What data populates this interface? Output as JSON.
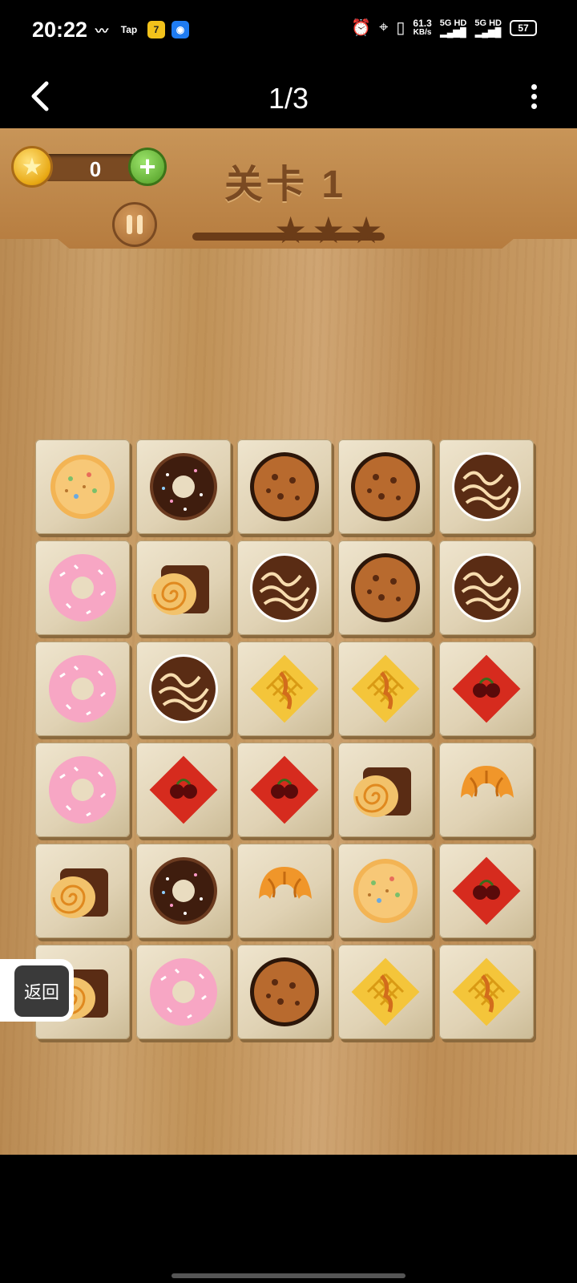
{
  "status_bar": {
    "time": "20:22",
    "left_icons": [
      "voice-wave-icon",
      "tap-icon",
      "seven-icon",
      "app-icon"
    ],
    "tap_text": "Tap",
    "seven_text": "7",
    "network_speed": "61.3",
    "network_unit": "KB/s",
    "signal1": "5G HD",
    "signal2": "5G HD",
    "battery": "57"
  },
  "nav": {
    "page_indicator": "1/3"
  },
  "game": {
    "coins": "0",
    "level_title": "关卡 1",
    "stars_earned": 0,
    "stars_total": 3,
    "return_label": "返回",
    "grid": [
      [
        "cookie",
        "choco-donut",
        "choc-chip",
        "choc-chip",
        "swirl-cookie"
      ],
      [
        "pink-donut",
        "swiss-roll",
        "swirl-cookie",
        "choc-chip",
        "swirl-cookie"
      ],
      [
        "pink-donut",
        "swirl-cookie",
        "waffle",
        "waffle",
        "cherry-diamond"
      ],
      [
        "pink-donut",
        "cherry-diamond",
        "cherry-diamond",
        "swiss-roll",
        "croissant"
      ],
      [
        "swiss-roll",
        "choco-donut",
        "croissant",
        "cookie",
        "cherry-diamond"
      ],
      [
        "swiss-roll",
        "pink-donut",
        "choc-chip",
        "waffle",
        "waffle"
      ]
    ]
  },
  "colors": {
    "wood_dark": "#7a4a22",
    "tile": "#e0d2b4"
  }
}
